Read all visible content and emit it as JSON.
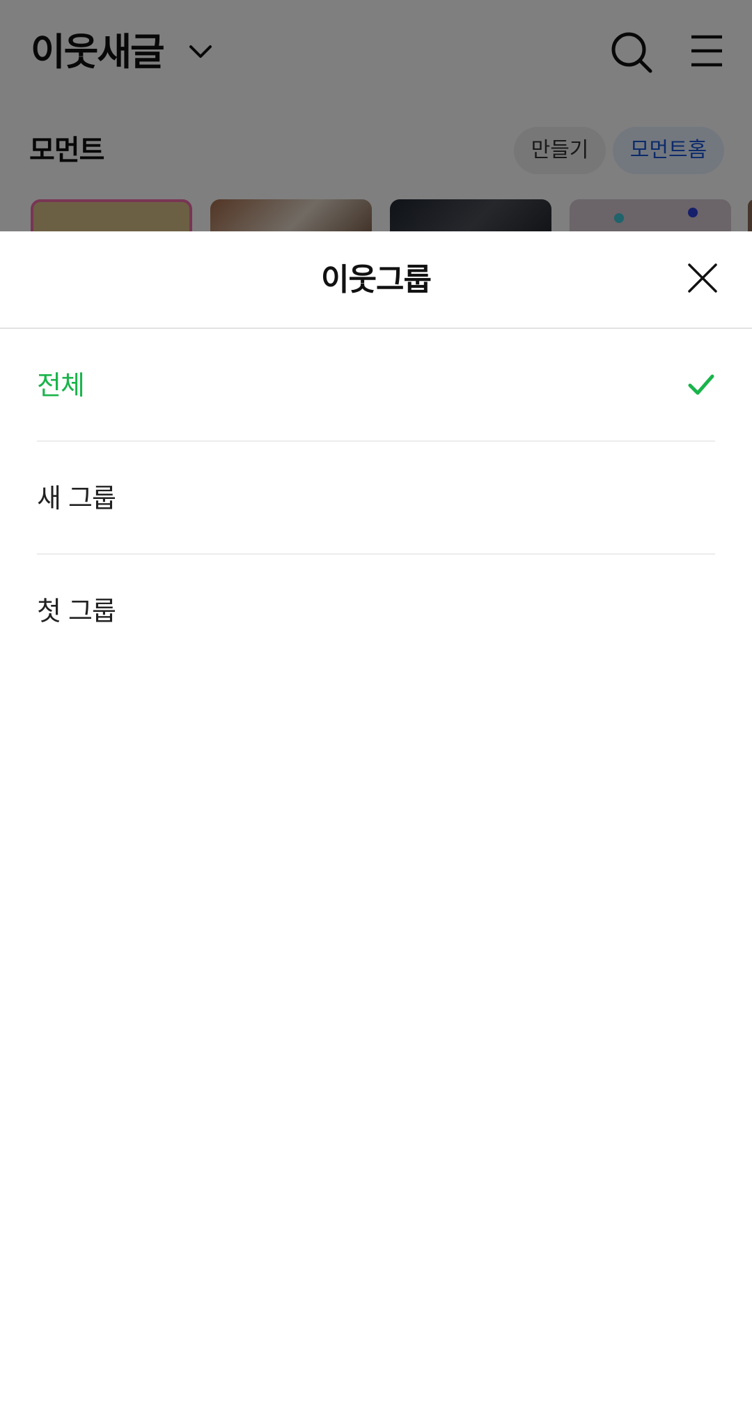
{
  "background": {
    "title": "이웃새글",
    "section_title": "모먼트",
    "chips": {
      "make": "만들기",
      "moment_home": "모먼트홈"
    },
    "icons": [
      "chevron-down-icon",
      "search-icon",
      "menu-icon"
    ]
  },
  "sheet": {
    "title": "이웃그룹",
    "close_icon": "close-icon",
    "groups": [
      {
        "label": "전체",
        "selected": true
      },
      {
        "label": "새 그룹",
        "selected": false
      },
      {
        "label": "첫 그룹",
        "selected": false
      }
    ],
    "selected_color": "#19b44a",
    "check_icon": "check-icon"
  },
  "colors": {
    "accent_green": "#19b44a",
    "chip_blue": "#1a56d6",
    "overlay": "rgba(0,0,0,0.5)"
  }
}
